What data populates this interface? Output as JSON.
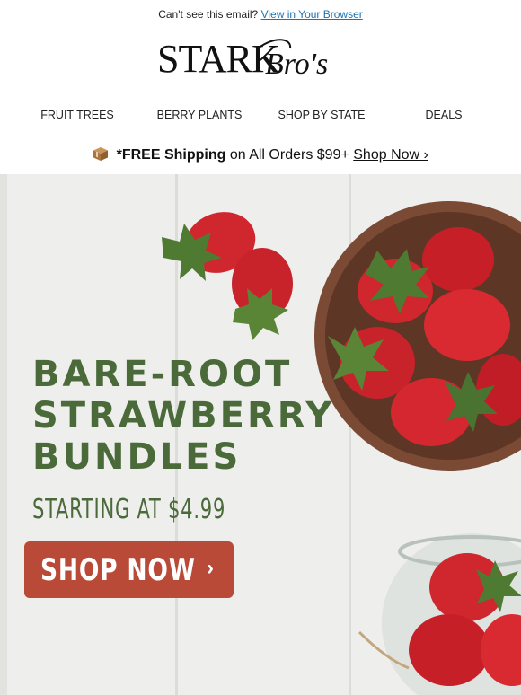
{
  "preheader": {
    "text": "Can't see this email?",
    "link": "View in Your Browser"
  },
  "brand": {
    "name_main": "STARK",
    "name_script": "Bro's"
  },
  "nav": {
    "items": [
      "FRUIT TREES",
      "BERRY PLANTS",
      "SHOP BY STATE",
      "DEALS"
    ]
  },
  "shipping": {
    "icon": "package-icon",
    "bold": "*FREE Shipping",
    "text": "on All Orders $99+",
    "link": "Shop Now ›"
  },
  "hero": {
    "headline": [
      "BARE-ROOT",
      "STRAWBERRY",
      "BUNDLES"
    ],
    "subhead": "STARTING AT $4.99",
    "cta_label": "SHOP NOW",
    "cta_chevron": "›"
  },
  "colors": {
    "accent_green": "#4a6a3a",
    "cta_red": "#b84a37",
    "link_blue": "#1a73b5"
  }
}
